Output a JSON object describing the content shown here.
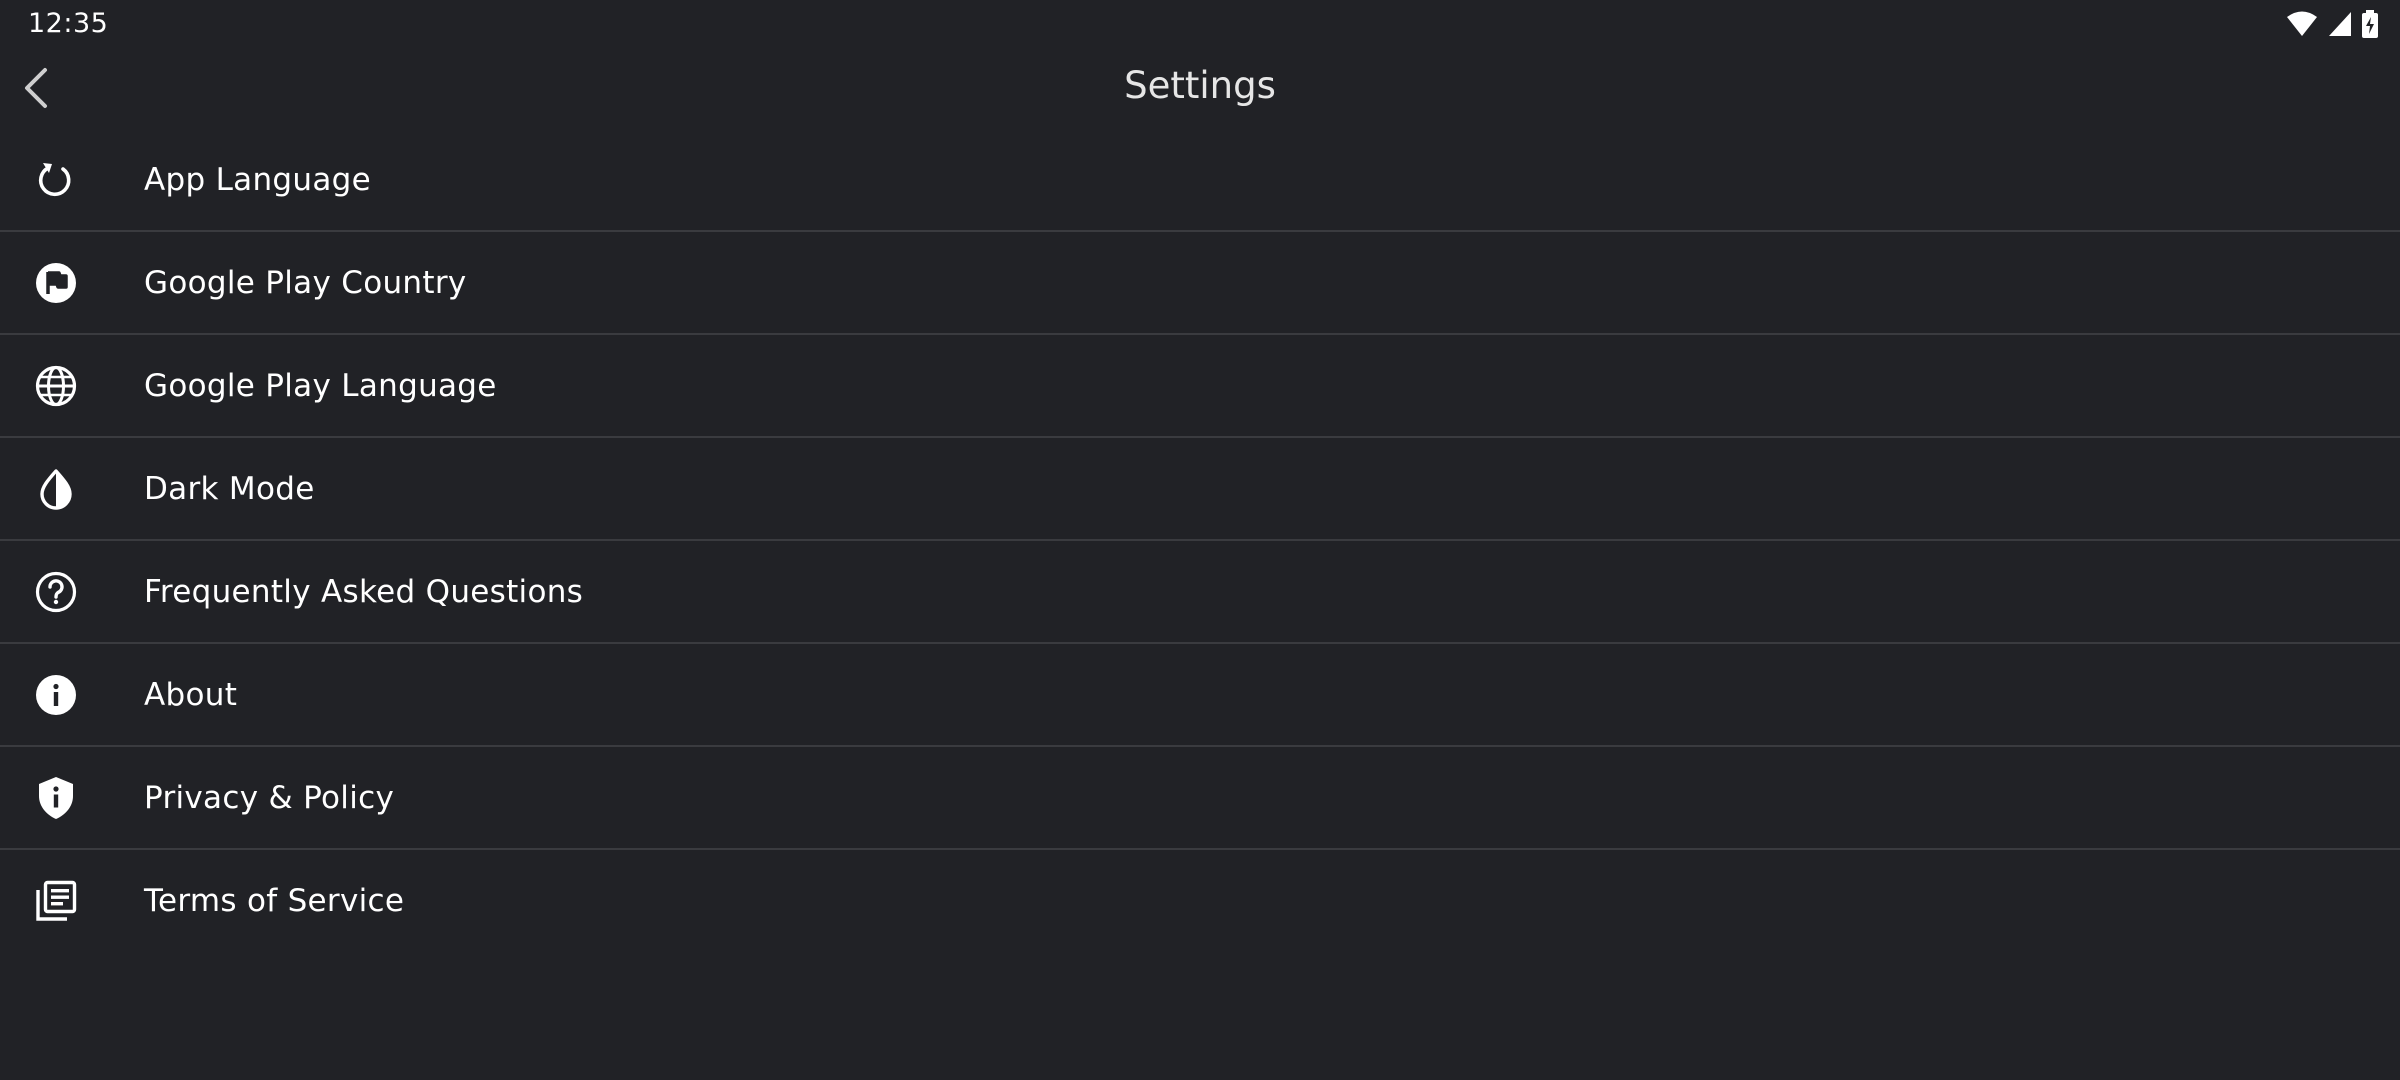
{
  "status_bar": {
    "time": "12:35",
    "icons": [
      "wifi-icon",
      "signal-icon",
      "battery-charging-icon"
    ]
  },
  "app_bar": {
    "title": "Settings",
    "back_icon": "chevron-left-icon"
  },
  "settings": {
    "items": [
      {
        "label": "App Language",
        "icon": "refresh-icon"
      },
      {
        "label": "Google Play Country",
        "icon": "flag-circle-icon"
      },
      {
        "label": "Google Play Language",
        "icon": "globe-icon"
      },
      {
        "label": "Dark Mode",
        "icon": "contrast-drop-icon"
      },
      {
        "label": "Frequently Asked Questions",
        "icon": "help-circle-icon"
      },
      {
        "label": "About",
        "icon": "info-icon"
      },
      {
        "label": "Privacy & Policy",
        "icon": "shield-info-icon"
      },
      {
        "label": "Terms of Service",
        "icon": "library-books-icon"
      }
    ]
  },
  "colors": {
    "background": "#212226",
    "divider": "#3a3b3f",
    "text": "#ffffff",
    "title": "#e6e6e6"
  }
}
